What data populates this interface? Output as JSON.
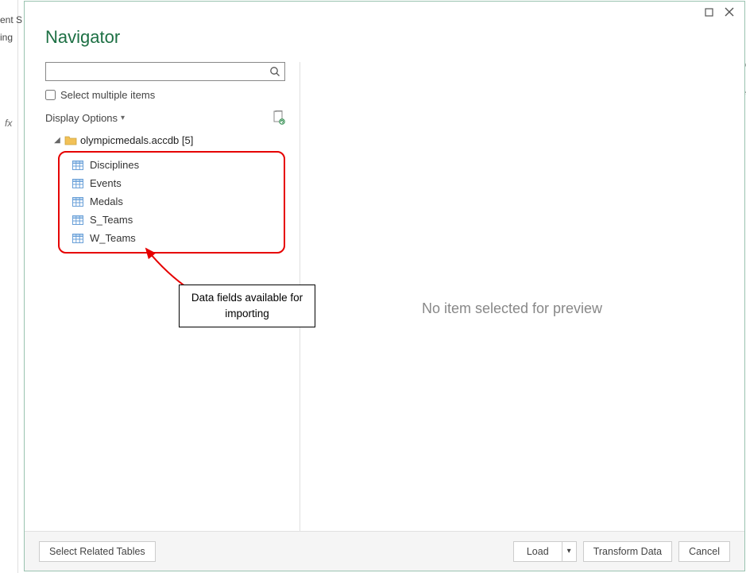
{
  "backgroundFragments": {
    "fx": "fx",
    "frag1": "ent S",
    "frag2": "ing",
    "frag3": "lf",
    "frag4": "re"
  },
  "dialog": {
    "title": "Navigator",
    "search": {
      "placeholder": ""
    },
    "selectMultipleLabel": "Select multiple items",
    "displayOptionsLabel": "Display Options",
    "tree": {
      "rootLabel": "olympicmedals.accdb [5]",
      "items": [
        {
          "label": "Disciplines"
        },
        {
          "label": "Events"
        },
        {
          "label": "Medals"
        },
        {
          "label": "S_Teams"
        },
        {
          "label": "W_Teams"
        }
      ]
    },
    "previewMessage": "No item selected for preview",
    "footer": {
      "selectRelated": "Select Related Tables",
      "load": "Load",
      "transform": "Transform Data",
      "cancel": "Cancel"
    }
  },
  "annotation": {
    "text": "Data fields available for importing"
  }
}
